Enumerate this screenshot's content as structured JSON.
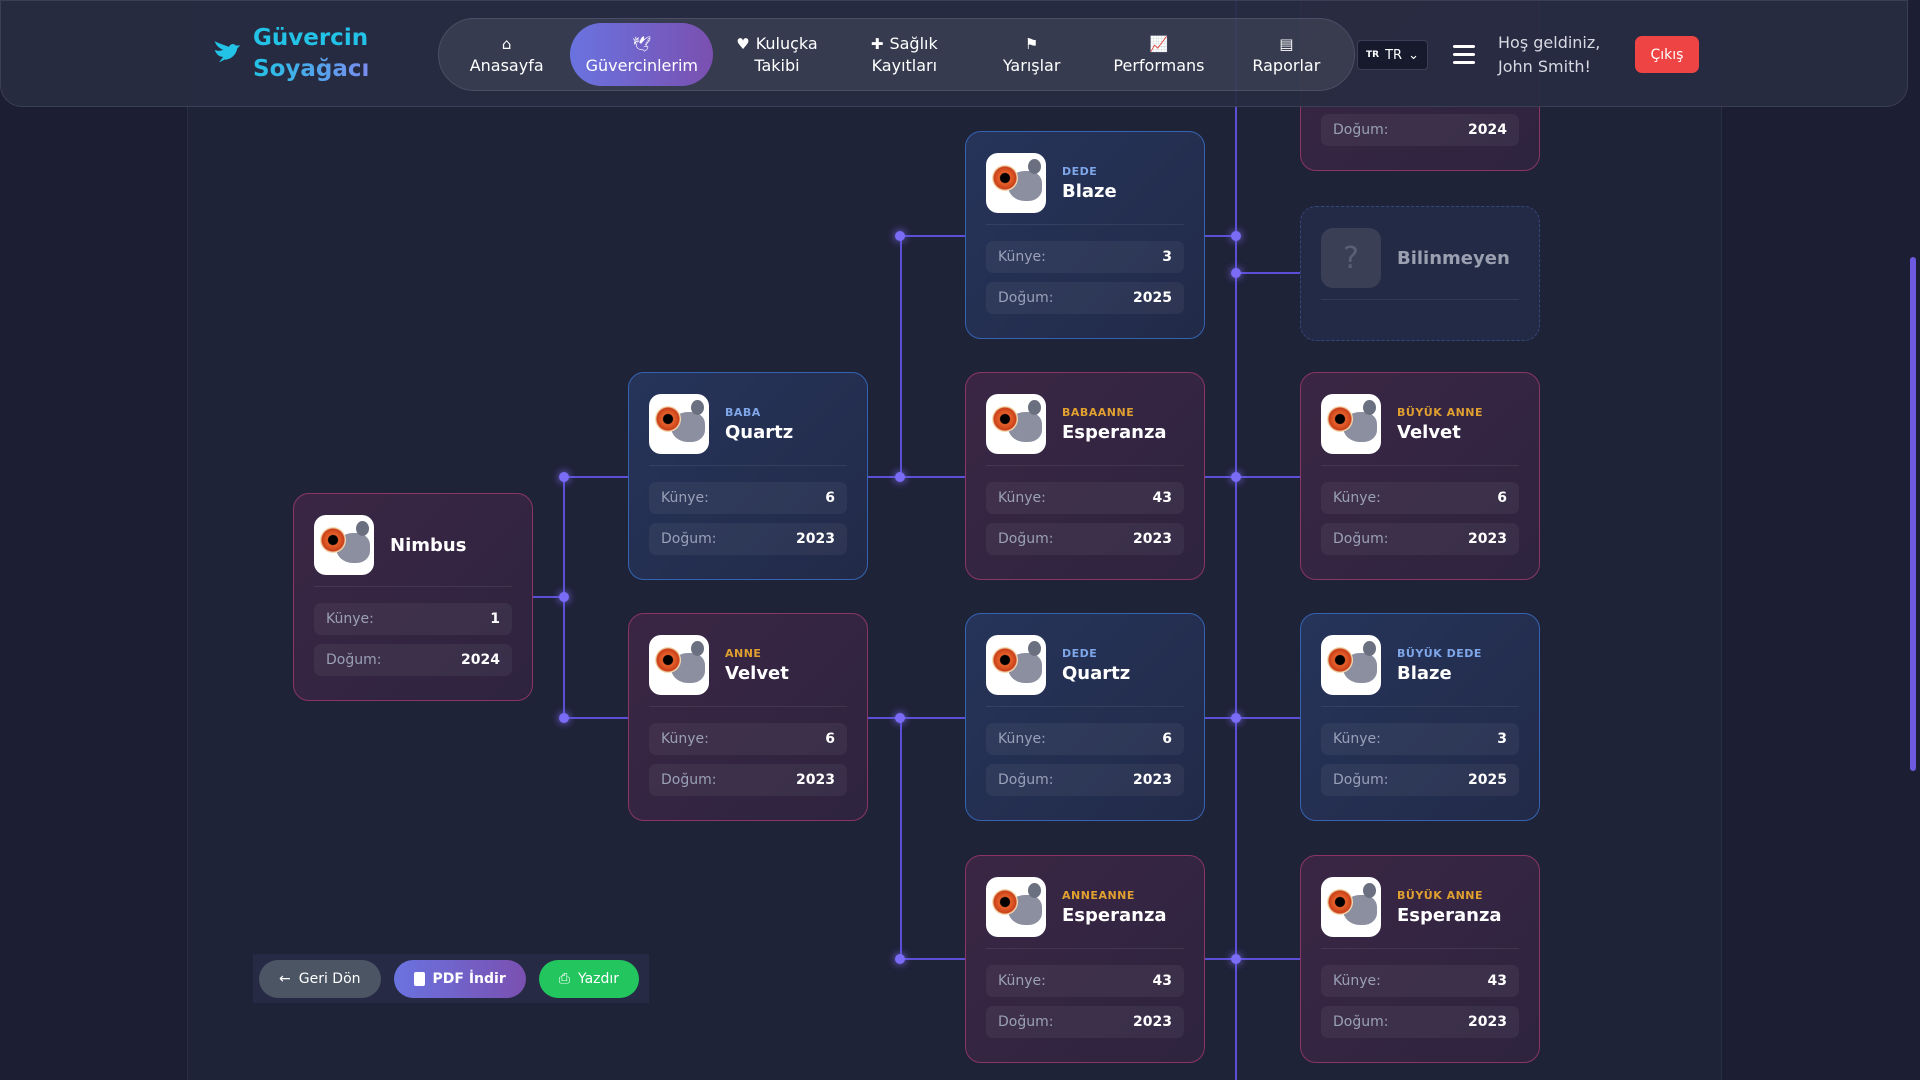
{
  "header": {
    "logo_line1": "Güvercin",
    "logo_line2": "Soyağacı",
    "nav": [
      {
        "label1": "Anasayfa",
        "label2": "",
        "icon": "home-icon"
      },
      {
        "label1": "Güvercinlerim",
        "label2": "",
        "icon": "dove-icon",
        "active": true
      },
      {
        "label1": "Kuluçka",
        "label2": "Takibi",
        "icon": "heart-icon"
      },
      {
        "label1": "Sağlık",
        "label2": "Kayıtları",
        "icon": "medical-icon"
      },
      {
        "label1": "Yarışlar",
        "label2": "",
        "icon": "flag-icon"
      },
      {
        "label1": "Performans",
        "label2": "",
        "icon": "chart-line-icon"
      },
      {
        "label1": "Raporlar",
        "label2": "",
        "icon": "chart-bar-icon"
      }
    ],
    "lang_flag": "TR",
    "lang": "TR",
    "welcome1": "Hoş geldiniz,",
    "welcome2": "John Smith!",
    "logout": "Çıkış"
  },
  "labels": {
    "kunye": "Künye:",
    "dogum": "Doğum:"
  },
  "cards": {
    "self": {
      "role": "",
      "name": "Nimbus",
      "kunye": "1",
      "dogum": "2024"
    },
    "baba": {
      "role": "BABA",
      "name": "Quartz",
      "kunye": "6",
      "dogum": "2023"
    },
    "anne": {
      "role": "ANNE",
      "name": "Velvet",
      "kunye": "6",
      "dogum": "2023"
    },
    "dede1": {
      "role": "DEDE",
      "name": "Blaze",
      "kunye": "3",
      "dogum": "2025"
    },
    "babaanne": {
      "role": "BABAANNE",
      "name": "Esperanza",
      "kunye": "43",
      "dogum": "2023"
    },
    "dede2": {
      "role": "DEDE",
      "name": "Quartz",
      "kunye": "6",
      "dogum": "2023"
    },
    "anneanne": {
      "role": "ANNEANNE",
      "name": "Esperanza",
      "kunye": "43",
      "dogum": "2023"
    },
    "top_partial": {
      "dogum": "2024"
    },
    "unknown": {
      "name": "Bilinmeyen",
      "icon": "?"
    },
    "ba1": {
      "role": "BÜYÜK ANNE",
      "name": "Velvet",
      "kunye": "6",
      "dogum": "2023"
    },
    "bd1": {
      "role": "BÜYÜK DEDE",
      "name": "Blaze",
      "kunye": "3",
      "dogum": "2025"
    },
    "ba2": {
      "role": "BÜYÜK ANNE",
      "name": "Esperanza",
      "kunye": "43",
      "dogum": "2023"
    }
  },
  "actions": {
    "back": "Geri Dön",
    "pdf": "PDF İndir",
    "print": "Yazdır"
  },
  "colors": {
    "accent": "#6a73e0",
    "logout": "#ef4444",
    "print": "#22c55e",
    "male_border": "#3563b0",
    "female_border": "#8a3468"
  }
}
